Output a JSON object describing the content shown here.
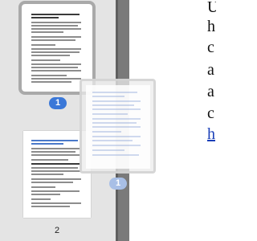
{
  "thumbnails": [
    {
      "page_number": "1",
      "selected": true
    },
    {
      "page_number": "2",
      "selected": false
    }
  ],
  "drag_ghost": {
    "page_number": "1"
  },
  "document_lines": [
    "U",
    "h",
    "c",
    "a",
    "a",
    "c",
    "h"
  ],
  "colors": {
    "accent": "#3b78d8",
    "pane_bg": "#e4e4e4",
    "gutter": "#7a7a7a",
    "link": "#1a3fb8"
  }
}
